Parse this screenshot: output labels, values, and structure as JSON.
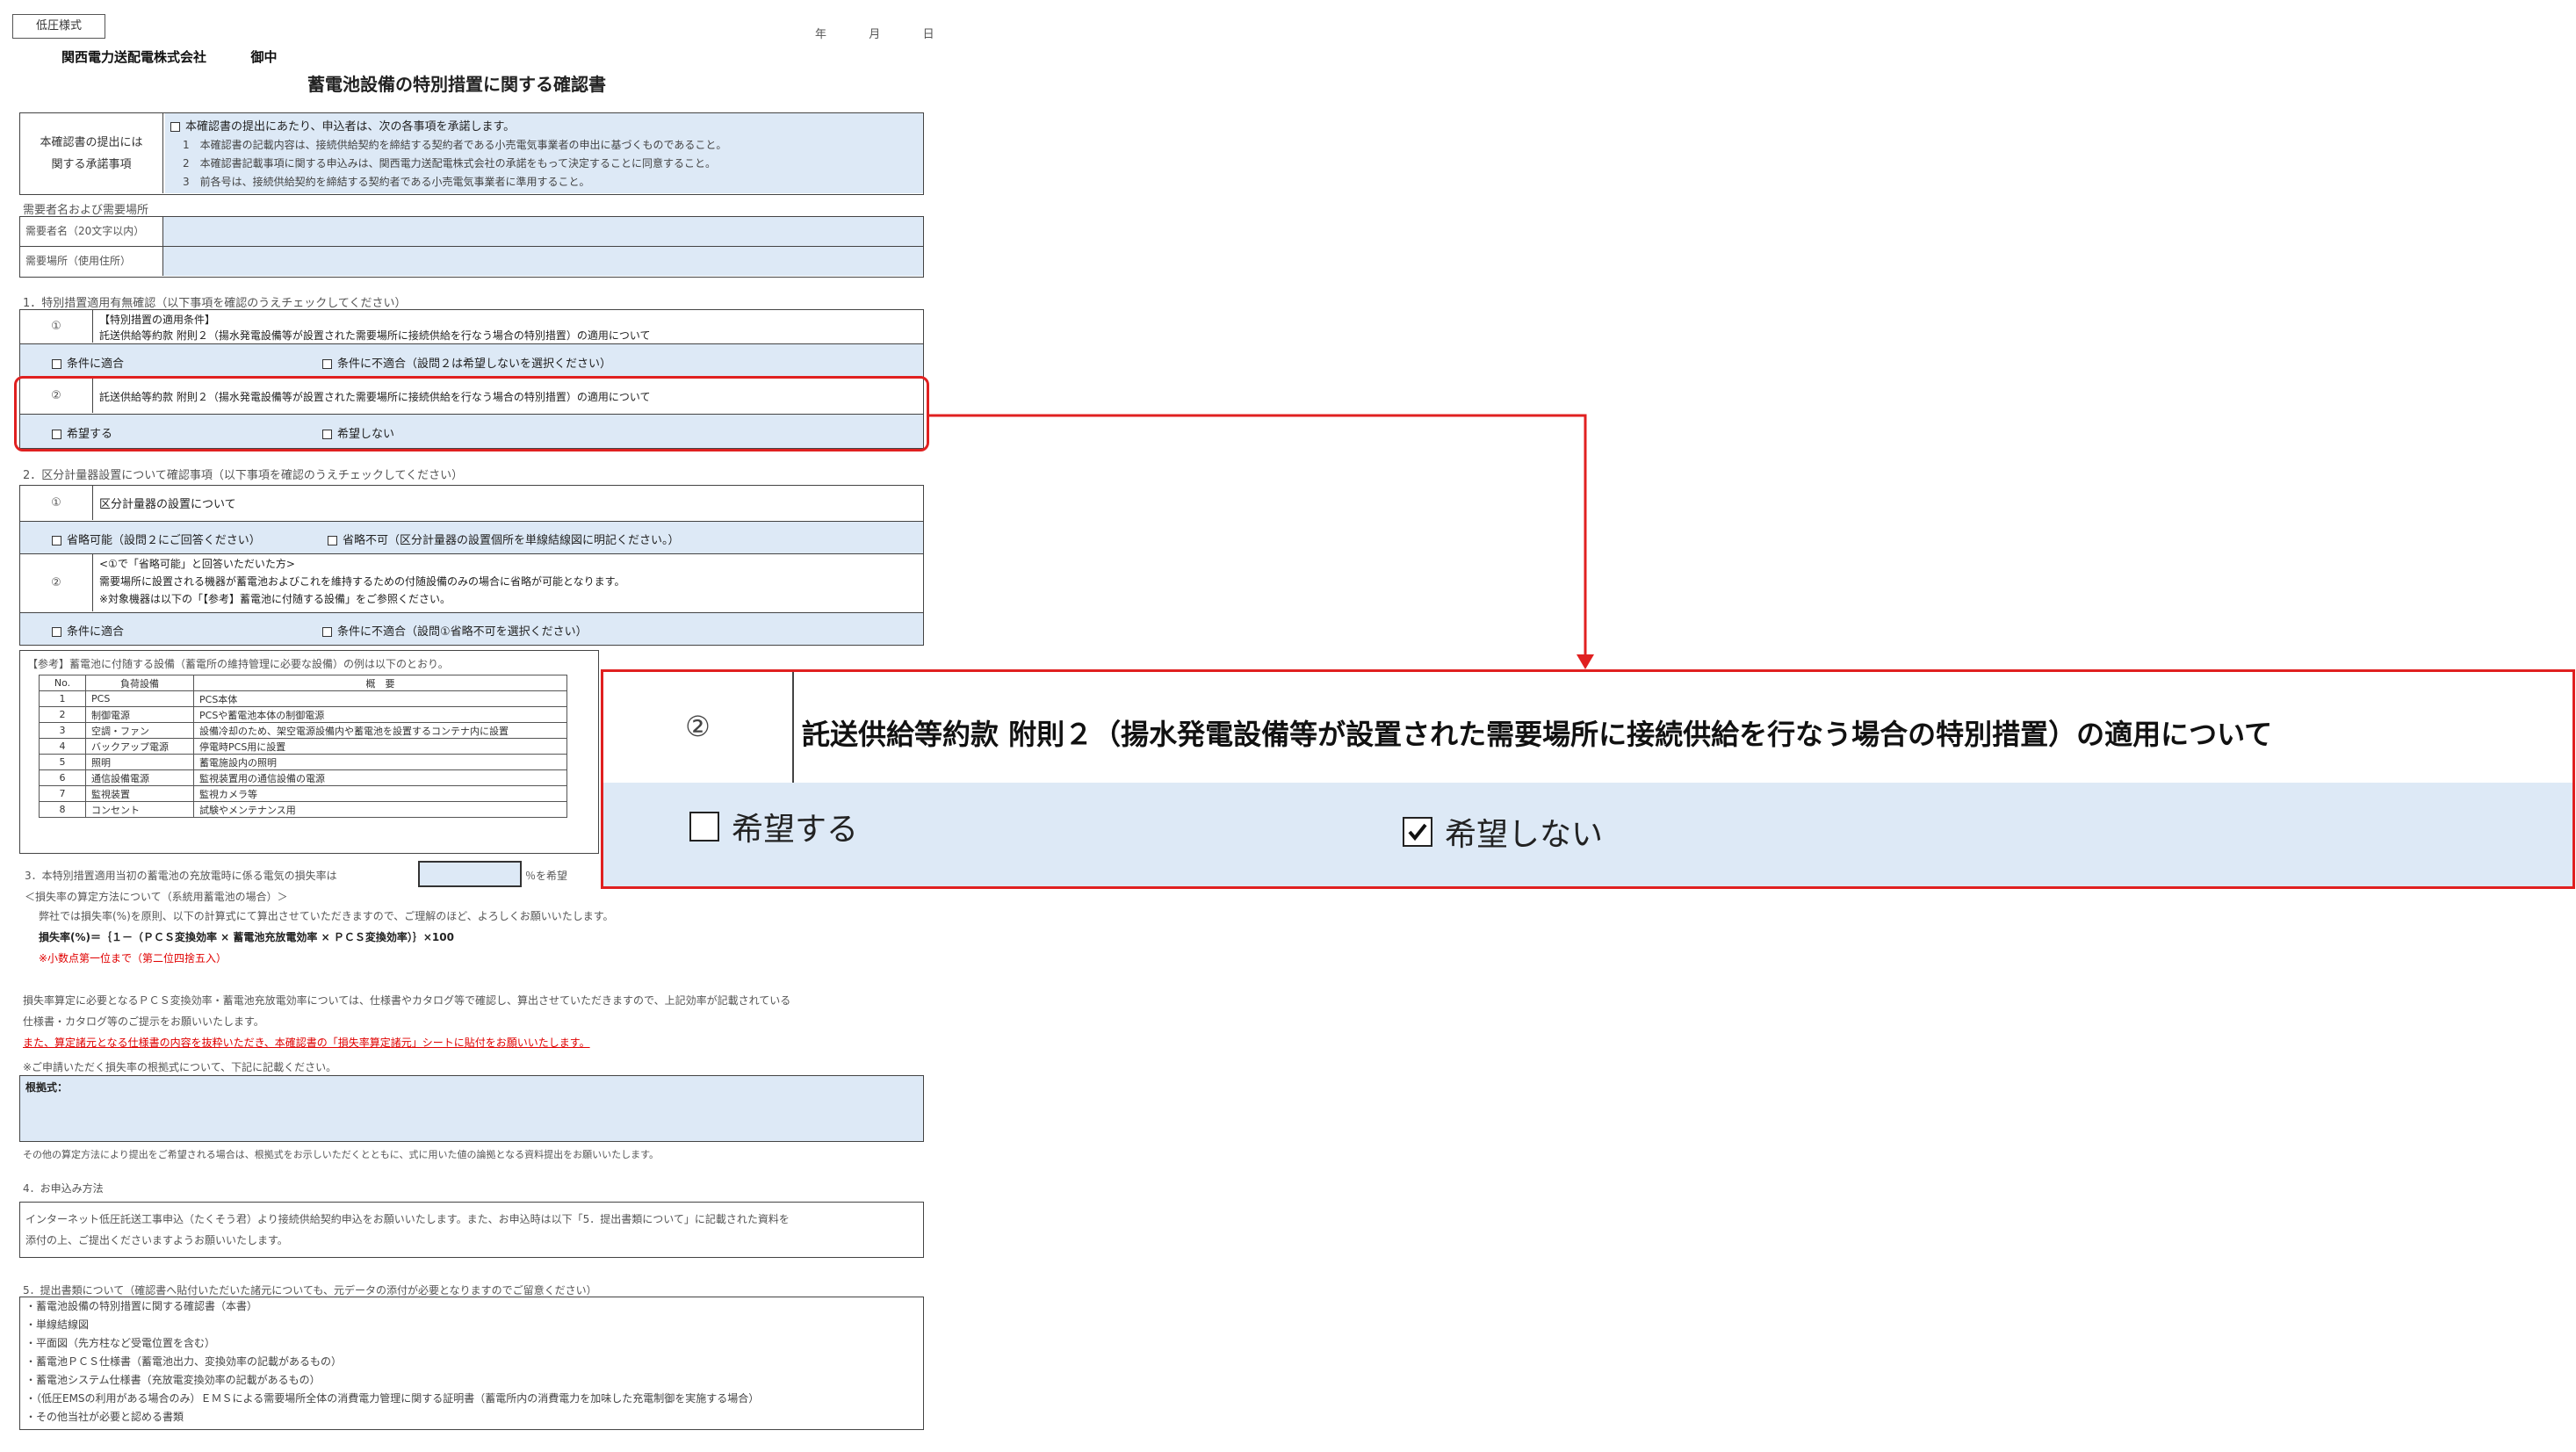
{
  "header": {
    "form_type": "低圧様式",
    "date_labels": [
      "年",
      "月",
      "日"
    ],
    "addressee": "関西電力送配電株式会社",
    "honorific": "御中",
    "title": "蓄電池設備の特別措置に関する確認書"
  },
  "consent": {
    "label_line1": "本確認書の提出には",
    "label_line2": "関する承諾事項",
    "lines": [
      "本確認書の提出にあたり、申込者は、次の各事項を承諾します。",
      "1　本確認書の記載内容は、接続供給契約を締結する契約者である小売電気事業者の申出に基づくものであること。",
      "2　本確認書記載事項に関する申込みは、関西電力送配電株式会社の承諾をもって決定することに同意すること。",
      "3　前各号は、接続供給契約を締結する契約者である小売電気事業者に準用すること。"
    ]
  },
  "customer": {
    "section_label": "需要者名および需要場所",
    "name_label": "需要者名（20文字以内）",
    "place_label": "需要場所（使用住所）"
  },
  "section1": {
    "heading": "1．特別措置適用有無確認（以下事項を確認のうえチェックしてください）",
    "item1_num": "①",
    "item1_title": "【特別措置の適用条件】",
    "item1_text": "託送供給等約款 附則２（揚水発電設備等が設置された需要場所に接続供給を行なう場合の特別措置）の適用について",
    "item1_opt_yes": "条件に適合",
    "item1_opt_no": "条件に不適合（設問２は希望しないを選択ください）",
    "item2_num": "②",
    "item2_text": "託送供給等約款 附則２（揚水発電設備等が設置された需要場所に接続供給を行なう場合の特別措置）の適用について",
    "item2_opt_yes": "希望する",
    "item2_opt_no": "希望しない"
  },
  "section2": {
    "heading": "2．区分計量器設置について確認事項（以下事項を確認のうえチェックしてください）",
    "item1_num": "①",
    "item1_text": "区分計量器の設置について",
    "item1_opt_yes": "省略可能（設問２にご回答ください）",
    "item1_opt_no": "省略不可（区分計量器の設置個所を単線結線図に明記ください。）",
    "item2_num": "②",
    "item2_lines": [
      "<①で「省略可能」と回答いただいた方>",
      "需要場所に設置される機器が蓄電池およびこれを維持するための付随設備のみの場合に省略が可能となります。",
      "※対象機器は以下の「【参考】蓄電池に付随する設備」をご参照ください。"
    ],
    "item2_opt_yes": "条件に適合",
    "item2_opt_no": "条件に不適合（設問①省略不可を選択ください）"
  },
  "reference": {
    "heading": "【参考】蓄電池に付随する設備（蓄電所の維持管理に必要な設備）の例は以下のとおり。",
    "columns": [
      "No.",
      "負荷設備",
      "概　要"
    ],
    "rows": [
      [
        "1",
        "PCS",
        "PCS本体"
      ],
      [
        "2",
        "制御電源",
        "PCSや蓄電池本体の制御電源"
      ],
      [
        "3",
        "空調・ファン",
        "設備冷却のため、架空電源設備内や蓄電池を設置するコンテナ内に設置"
      ],
      [
        "4",
        "バックアップ電源",
        "停電時PCS用に設置"
      ],
      [
        "5",
        "照明",
        "蓄電施設内の照明"
      ],
      [
        "6",
        "通信設備電源",
        "監視装置用の通信設備の電源"
      ],
      [
        "7",
        "監視装置",
        "監視カメラ等"
      ],
      [
        "8",
        "コンセント",
        "試験やメンテナンス用"
      ]
    ]
  },
  "section3": {
    "heading": "3．本特別措置適用当初の蓄電池の充放電時に係る電気の損失率は",
    "suffix": "％を希望",
    "method_heading": "＜損失率の算定方法について（系統用蓄電池の場合）＞",
    "method_text": "弊社では損失率(%)を原則、以下の計算式にて算出させていただきますので、ご理解のほど、よろしくお願いいたします。",
    "formula": "損失率(%)＝｛１－（ＰＣＳ変換効率 × 蓄電池充放電効率 × ＰＣＳ変換効率）｝×100",
    "rounding": "※小数点第一位まで（第二位四捨五入）",
    "note1": "損失率算定に必要となるＰＣＳ変換効率・蓄電池充放電効率については、仕様書やカタログ等で確認し、算出させていただきますので、上記効率が記載されている",
    "note2": "仕様書・カタログ等のご提示をお願いいたします。",
    "note_red": "また、算定諸元となる仕様書の内容を抜粋いただき、本確認書の「損失率算定諸元」シートに貼付をお願いいたします。",
    "basis_label": "※ご申請いただく損失率の根拠式について、下記に記載ください。",
    "basis_box_label": "根拠式：",
    "after_note": "その他の算定方法により提出をご希望される場合は、根拠式をお示しいただくとともに、式に用いた値の論拠となる資料提出をお願いいたします。"
  },
  "section4": {
    "heading": "4．お申込み方法",
    "line1": "インターネット低圧託送工事申込（たくそう君）より接続供給契約申込をお願いいたします。また、お申込時は以下「5．提出書類について」に記載された資料を",
    "line2": "添付の上、ご提出くださいますようお願いいたします。"
  },
  "section5": {
    "heading": "5．提出書類について（確認書へ貼付いただいた諸元についても、元データの添付が必要となりますのでご留意ください）",
    "items": [
      "・蓄電池設備の特別措置に関する確認書（本書）",
      "・単線結線図",
      "・平面図（先方柱など受電位置を含む）",
      "・蓄電池ＰＣＳ仕様書（蓄電池出力、変換効率の記載があるもの）",
      "・蓄電池システム仕様書（充放電変換効率の記載があるもの）",
      "・（低圧EMSの利用がある場合のみ）ＥＭＳによる需要場所全体の消費電力管理に関する証明書（蓄電所内の消費電力を加味した充電制御を実施する場合）",
      "・その他当社が必要と認める書類"
    ]
  },
  "zoom": {
    "num": "②",
    "text": "託送供給等約款 附則２（揚水発電設備等が設置された需要場所に接続供給を行なう場合の特別措置）の適用について",
    "opt_yes": "希望する",
    "opt_no": "希望しない",
    "opt_yes_checked": false,
    "opt_no_checked": true
  },
  "colors": {
    "highlight": "#e02020",
    "cell_fill": "#dde9f6"
  }
}
